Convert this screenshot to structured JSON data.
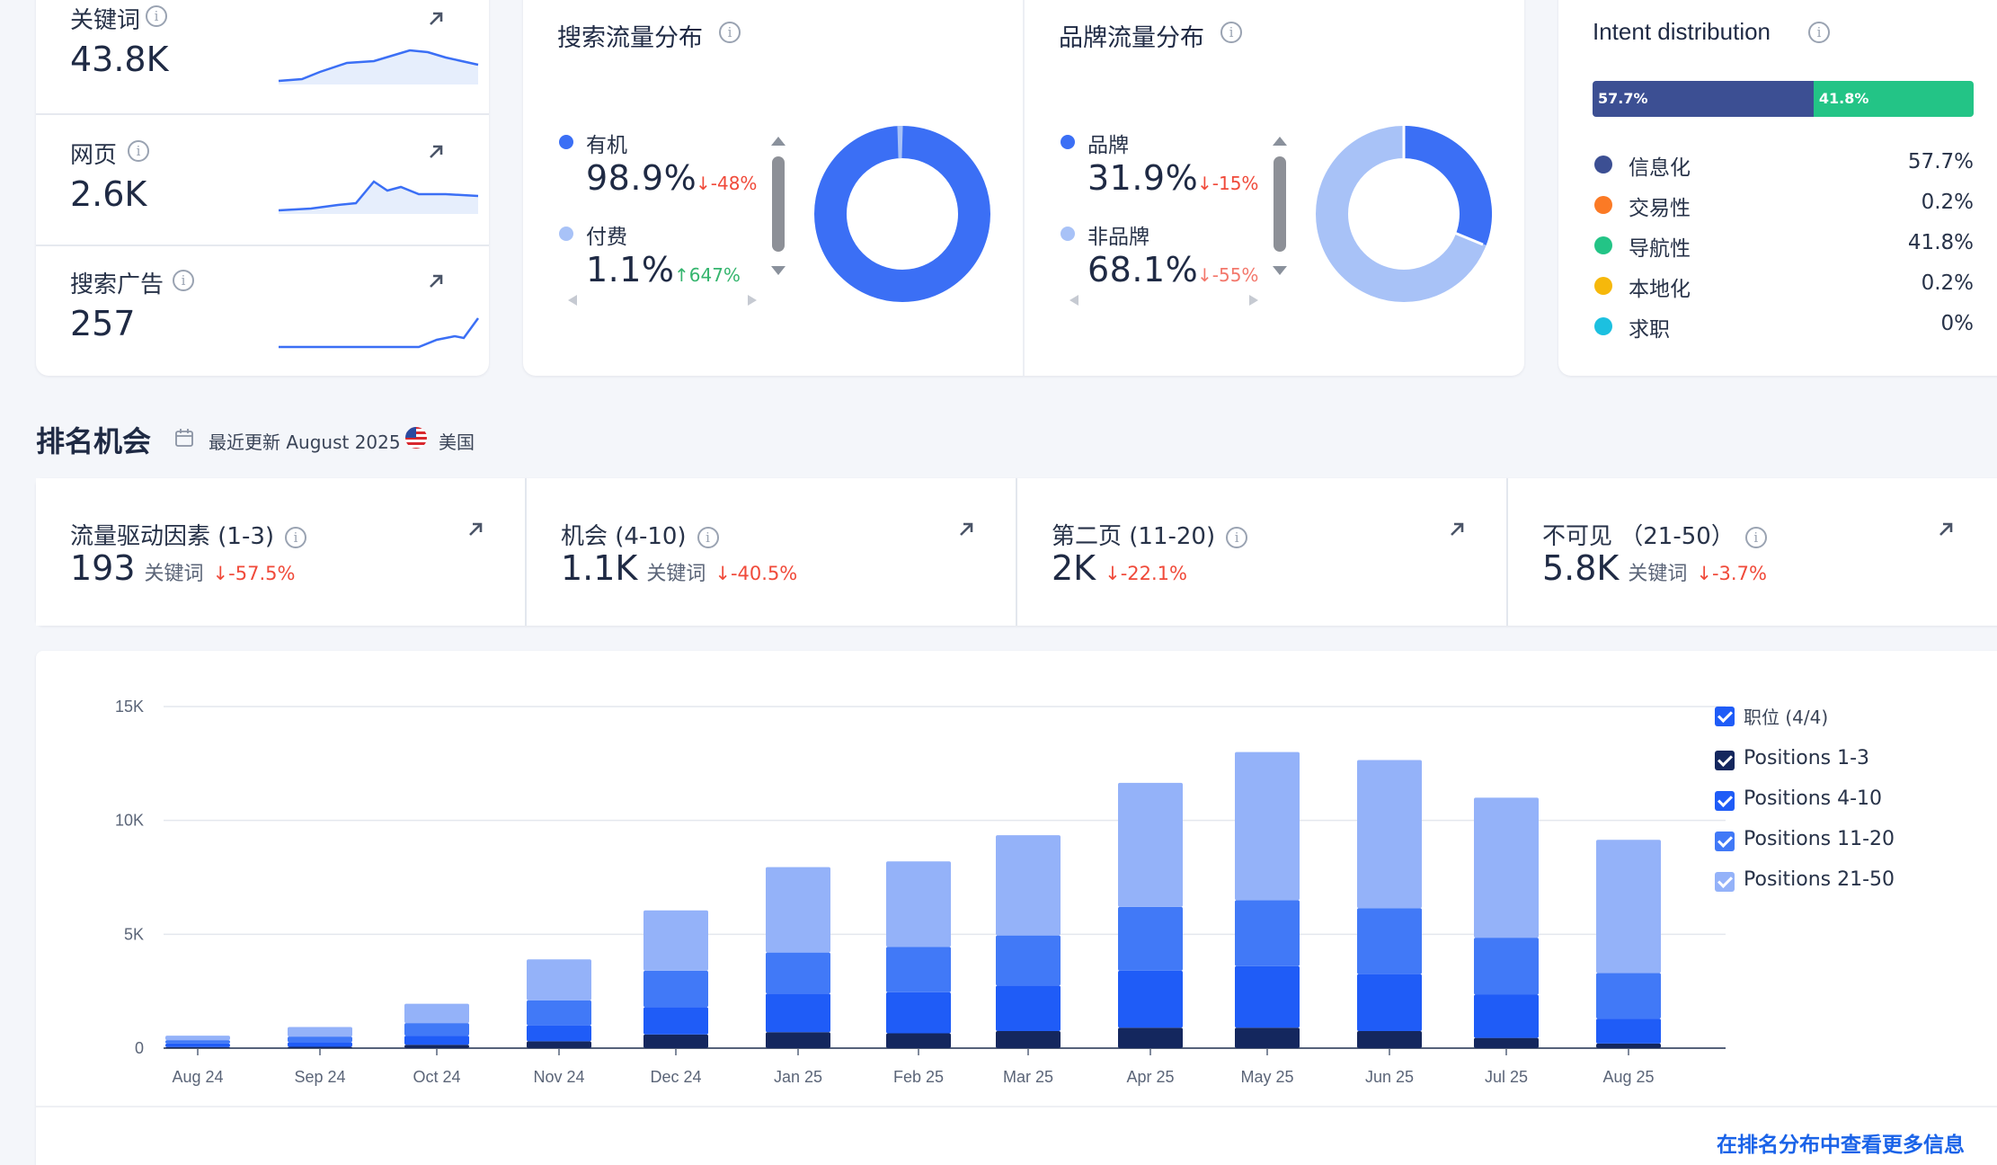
{
  "kpis": [
    {
      "label": "关键词",
      "value": "43.8K"
    },
    {
      "label": "网页",
      "value": "2.6K"
    },
    {
      "label": "搜索广告",
      "value": "257"
    }
  ],
  "search_traffic": {
    "title": "搜索流量分布",
    "items": [
      {
        "label": "有机",
        "pct": "98.9%",
        "change": "↓-48%",
        "color": "#3b6ff5"
      },
      {
        "label": "付费",
        "pct": "1.1%",
        "change": "↑647%",
        "color": "#a8c2f7"
      }
    ]
  },
  "brand_traffic": {
    "title": "品牌流量分布",
    "items": [
      {
        "label": "品牌",
        "pct": "31.9%",
        "change": "↓-15%",
        "color": "#3b6ff5"
      },
      {
        "label": "非品牌",
        "pct": "68.1%",
        "change": "↓-55%",
        "color": "#a8c2f7"
      }
    ]
  },
  "intent": {
    "title": "Intent distribution",
    "bar": [
      {
        "label": "57.7%",
        "share": 57.7,
        "color": "#3c4f93"
      },
      {
        "label": "41.8%",
        "share": 41.8,
        "color": "#23c486"
      }
    ],
    "rows": [
      {
        "name": "信息化",
        "pct": "57.7%",
        "color": "#3c4f93"
      },
      {
        "name": "交易性",
        "pct": "0.2%",
        "color": "#fb7a25"
      },
      {
        "name": "导航性",
        "pct": "41.8%",
        "color": "#23c486"
      },
      {
        "name": "本地化",
        "pct": "0.2%",
        "color": "#f6b80b"
      },
      {
        "name": "求职",
        "pct": "0%",
        "color": "#1cc0e0"
      }
    ]
  },
  "ranking": {
    "title": "排名机会",
    "updated": "最近更新 August 2025",
    "country": "美国",
    "tiles": [
      {
        "title": "流量驱动因素 (1-3)",
        "value": "193",
        "unit": "关键词",
        "change": "↓-57.5%"
      },
      {
        "title": "机会 (4-10)",
        "value": "1.1K",
        "unit": "关键词",
        "change": "↓-40.5%"
      },
      {
        "title": "第二页 (11-20)",
        "value": "2K",
        "unit": "",
        "change": "↓-22.1%"
      },
      {
        "title": "不可见 （21-50）",
        "value": "5.8K",
        "unit": "关键词",
        "change": "↓-3.7%"
      }
    ]
  },
  "legend": {
    "header": "职位 (4/4)",
    "items": [
      "Positions 1-3",
      "Positions 4-10",
      "Positions 11-20",
      "Positions 21-50"
    ]
  },
  "more_link": "在排名分布中查看更多信息",
  "chart_data": {
    "type": "bar",
    "stacked": true,
    "categories": [
      "Aug 24",
      "Sep 24",
      "Oct 24",
      "Nov 24",
      "Dec 24",
      "Jan 25",
      "Feb 25",
      "Mar 25",
      "Apr 25",
      "May 25",
      "Jun 25",
      "Jul 25",
      "Aug 25"
    ],
    "series": [
      {
        "name": "Positions 1-3",
        "color": "#14275e",
        "values": [
          50,
          60,
          150,
          300,
          600,
          700,
          650,
          750,
          900,
          900,
          750,
          450,
          200
        ]
      },
      {
        "name": "Positions 4-10",
        "color": "#1f5cf7",
        "values": [
          150,
          200,
          400,
          700,
          1200,
          1700,
          1800,
          2000,
          2500,
          2700,
          2500,
          1900,
          1100
        ]
      },
      {
        "name": "Positions 11-20",
        "color": "#4179f7",
        "values": [
          150,
          250,
          550,
          1100,
          1600,
          1800,
          2000,
          2200,
          2800,
          2900,
          2900,
          2500,
          2000
        ]
      },
      {
        "name": "Positions 21-50",
        "color": "#94b2f9",
        "values": [
          200,
          420,
          850,
          1800,
          2650,
          3750,
          3750,
          4400,
          5450,
          6500,
          6500,
          6150,
          5850
        ]
      }
    ],
    "ylim": [
      0,
      15000
    ],
    "yticks": [
      "0",
      "5K",
      "10K",
      "15K"
    ]
  }
}
